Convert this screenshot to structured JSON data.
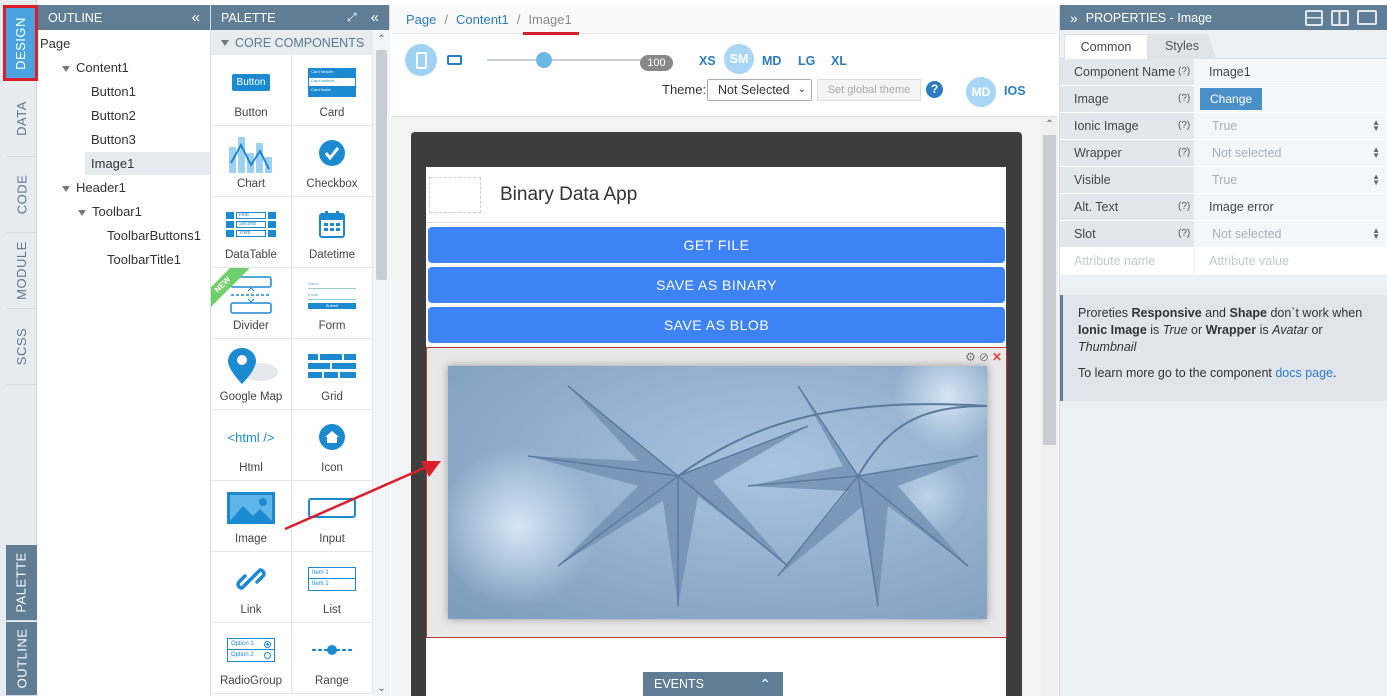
{
  "left_tabs": [
    "DESIGN",
    "DATA",
    "CODE",
    "MODULE",
    "SCSS"
  ],
  "left_tabs_bottom": [
    "PALETTE",
    "OUTLINE"
  ],
  "outline": {
    "title": "OUTLINE",
    "items": [
      {
        "label": "Page",
        "level": 0
      },
      {
        "label": "Content1",
        "level": 1,
        "expanded": true
      },
      {
        "label": "Button1",
        "level": 2
      },
      {
        "label": "Button2",
        "level": 2
      },
      {
        "label": "Button3",
        "level": 2
      },
      {
        "label": "Image1",
        "level": 2,
        "selected": true
      },
      {
        "label": "Header1",
        "level": 1,
        "expanded": true
      },
      {
        "label": "Toolbar1",
        "level": 2,
        "expanded": true
      },
      {
        "label": "ToolbarButtons1",
        "level": 3
      },
      {
        "label": "ToolbarTitle1",
        "level": 3
      }
    ]
  },
  "palette": {
    "title": "PALETTE",
    "section": "CORE COMPONENTS",
    "items": [
      "Button",
      "Card",
      "Chart",
      "Checkbox",
      "DataTable",
      "Datetime",
      "Divider",
      "Form",
      "Google Map",
      "Grid",
      "Html",
      "Icon",
      "Image",
      "Input",
      "Link",
      "List",
      "RadioGroup",
      "Range"
    ],
    "new_ribbon": "NEW",
    "icon_texts": {
      "button": "Button",
      "card_lines": [
        "Card header",
        "Card content",
        "Card footer"
      ],
      "datatable": [
        "First",
        "Second",
        "Third"
      ],
      "html": "<html />",
      "form_labels": [
        "Name",
        "Email"
      ],
      "form_submit": "Submit",
      "list": [
        "Item 1",
        "Item 2"
      ],
      "radio": [
        "Option 1",
        "Option 2"
      ]
    }
  },
  "breadcrumb": {
    "items": [
      "Page",
      "Content1"
    ],
    "current": "Image1"
  },
  "toolbar": {
    "slider_value": "100",
    "breakpoints": [
      "XS",
      "SM",
      "MD",
      "LG",
      "XL"
    ],
    "active_breakpoint": "SM",
    "theme_label": "Theme:",
    "theme_value": "Not Selected",
    "global_theme_btn": "Set global theme",
    "help": "?",
    "md_badge": "MD",
    "ios_label": "IOS"
  },
  "app_preview": {
    "title": "Binary Data App",
    "buttons": [
      "GET FILE",
      "SAVE AS BINARY",
      "SAVE AS BLOB"
    ],
    "events_label": "EVENTS"
  },
  "properties": {
    "title": "PROPERTIES - Image",
    "tabs": [
      "Common",
      "Styles"
    ],
    "active_tab": "Common",
    "rows": [
      {
        "key": "Component Name",
        "help": "(?)",
        "value": "Image1",
        "muted": false
      },
      {
        "key": "Image",
        "help": "(?)",
        "value": "Change",
        "button": true
      },
      {
        "key": "Ionic Image",
        "help": "(?)",
        "value": "True",
        "muted": true,
        "select": true
      },
      {
        "key": "Wrapper",
        "help": "(?)",
        "value": "Not selected",
        "muted": true,
        "select": true
      },
      {
        "key": "Visible",
        "help": "",
        "value": "True",
        "muted": true,
        "select": true
      },
      {
        "key": "Alt. Text",
        "help": "(?)",
        "value": "Image error",
        "muted": false
      },
      {
        "key": "Slot",
        "help": "(?)",
        "value": "Not selected",
        "muted": true,
        "select": true
      }
    ],
    "attr_name_placeholder": "Attribute name",
    "attr_value_placeholder": "Attribute value",
    "info": {
      "p1_a": "Proreties ",
      "p1_b": "Responsive",
      "p1_c": " and ",
      "p1_d": "Shape",
      "p1_e": " don`t work when ",
      "p1_f": "Ionic Image",
      "p1_g": " is ",
      "p1_h": "True",
      "p1_i": " or ",
      "p1_j": "Wrapper",
      "p1_k": " is ",
      "p1_l": "Avatar",
      "p1_m": " or ",
      "p1_n": "Thumbnail",
      "p2_a": "To learn more go to the component ",
      "p2_link": "docs page",
      "p2_b": "."
    }
  },
  "colors": {
    "accent": "#4aa3df",
    "header": "#5f7d95",
    "button_blue": "#3d83f6",
    "highlight_red": "#d9202a"
  }
}
